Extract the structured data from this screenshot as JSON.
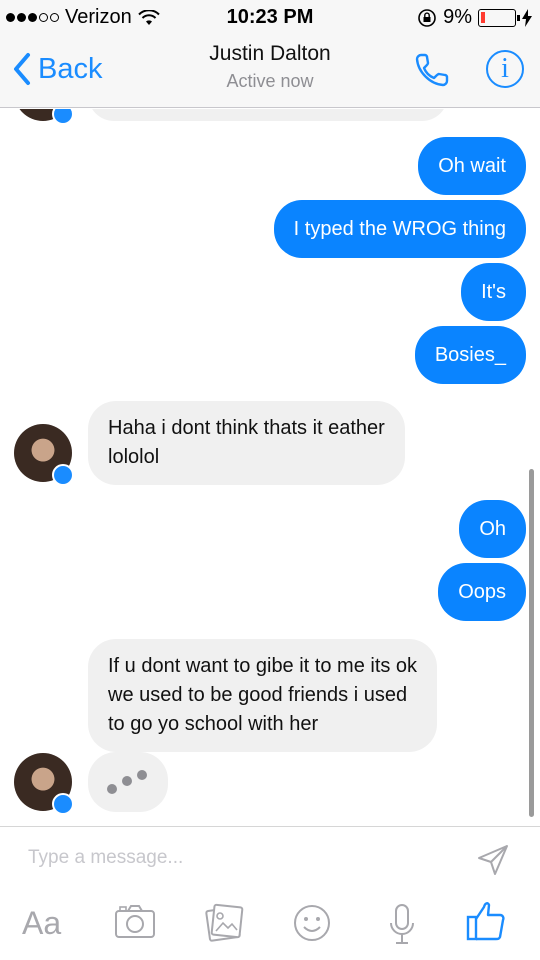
{
  "status_bar": {
    "carrier": "Verizon",
    "time": "10:23 PM",
    "battery_percent": "9%"
  },
  "nav": {
    "back_label": "Back",
    "title": "Justin Dalton",
    "subtitle": "Active now"
  },
  "messages": [
    {
      "from": "me",
      "text": "Oh wait"
    },
    {
      "from": "me",
      "text": "I typed the WROG thing"
    },
    {
      "from": "me",
      "text": "It's"
    },
    {
      "from": "me",
      "text": "Bosies_"
    },
    {
      "from": "them",
      "lines": [
        "Haha i dont think thats it eather",
        "lololol"
      ]
    },
    {
      "from": "me",
      "text": "Oh"
    },
    {
      "from": "me",
      "text": "Oops"
    },
    {
      "from": "them",
      "lines": [
        "If u dont want to gibe it to me its ok",
        "we used to be good friends i used",
        "to go yo school with her"
      ]
    }
  ],
  "composer": {
    "placeholder": "Type a message...",
    "aa_label": "Aa"
  },
  "colors": {
    "accent": "#1a8cff",
    "outgoing_bubble": "#0a84ff",
    "incoming_bubble": "#f0f0f0"
  },
  "icons": [
    "back-chevron-icon",
    "phone-icon",
    "info-icon",
    "send-icon",
    "camera-icon",
    "photo-icon",
    "emoji-icon",
    "microphone-icon",
    "thumbs-up-icon",
    "messenger-badge-icon"
  ]
}
